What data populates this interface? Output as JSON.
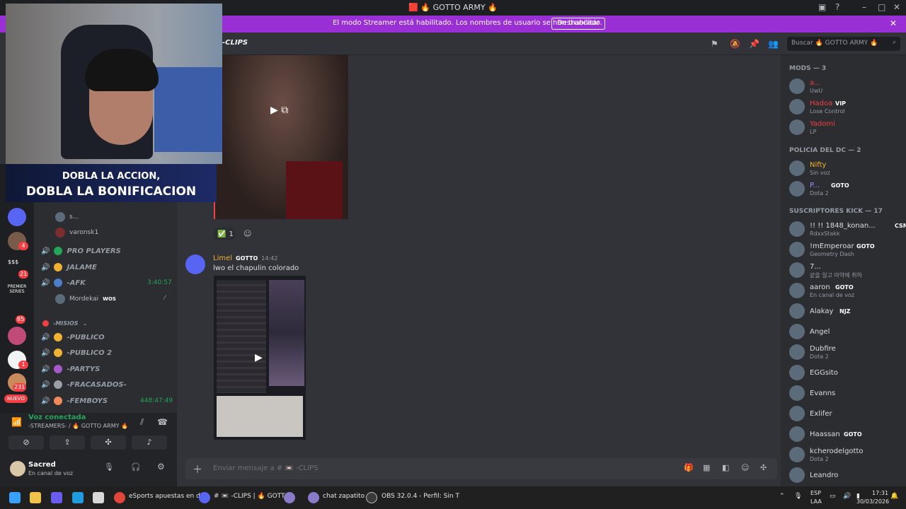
{
  "window": {
    "title": "🟥 🔥 GOTTO ARMY 🔥"
  },
  "banner": {
    "message": "El modo Streamer está habilitado. Los nombres de usuario se han truncado.",
    "button": "Deshabilitar"
  },
  "overlay": {
    "line1": "DOBLA LA ACCION,",
    "line2": "DOBLA LA BONIFICACION"
  },
  "rail": {
    "badges": [
      "4",
      "21",
      "85",
      "1",
      "231"
    ],
    "labels": [
      "$$$",
      "PREMIER SERIES"
    ],
    "new_label": "NUEVO"
  },
  "channels": {
    "voice_users_top": [
      "s...",
      "varonsk1"
    ],
    "items": [
      {
        "name": "PRO PLAYERS"
      },
      {
        "name": "JALAME"
      },
      {
        "name": "-AFK",
        "timer": "3:40:57"
      },
      {
        "name": "-PUBLICO"
      },
      {
        "name": "-PUBLICO 2"
      },
      {
        "name": "-PARTYS"
      },
      {
        "name": "-FRACASADOS-"
      },
      {
        "name": "-FEMBOYS",
        "timer": "448:47:49"
      }
    ],
    "afk_user": "Mordekai",
    "afk_user_tag": "WOS",
    "category": "-MISIOS"
  },
  "voice": {
    "title": "Voz conectada",
    "subtitle": "-STREAMERS- / 🔥 GOTTO ARMY 🔥"
  },
  "user": {
    "name": "Sacred",
    "status": "En canal de voz"
  },
  "header": {
    "channel": "-CLIPS",
    "search_placeholder": "Buscar 🔥 GOTTO ARMY 🔥"
  },
  "messages": {
    "reaction_count": "1",
    "author": "Limel",
    "author_tag": "GOTTO",
    "time": "14:42",
    "text": "lwo el chapulin colorado"
  },
  "input": {
    "placeholder": "Enviar mensaje a # 📼 -CLIPS"
  },
  "members": {
    "groups": [
      {
        "label": "MODS — 3",
        "rows": [
          {
            "name": "a...",
            "sub": "UwU",
            "color": "#f23f43"
          },
          {
            "name": "Hadoa",
            "sub": "Lose Control",
            "color": "#f23f43",
            "tag": "VIP"
          },
          {
            "name": "Yadomi",
            "sub": "LP",
            "color": "#f23f43"
          }
        ]
      },
      {
        "label": "POLICIA DEL DC — 2",
        "rows": [
          {
            "name": "Nifty",
            "sub": "Sin voz",
            "color": "#f0b232"
          },
          {
            "name": "P...",
            "sub": "Dota 2",
            "color": "#a58dff",
            "tag": "GOTO"
          }
        ]
      },
      {
        "label": "SUSCRIPTORES KICK — 17",
        "rows": [
          {
            "name": "!! !! 1848_konan...",
            "sub": "RdxxStakk",
            "color": "#dbdee1",
            "tag": "CSM"
          },
          {
            "name": "!mEmperoar",
            "sub": "Geometry Dash",
            "color": "#dbdee1",
            "tag": "GOTO"
          },
          {
            "name": "7...",
            "sub": "같을 일고 마약에 취하",
            "color": "#dbdee1"
          },
          {
            "name": "aaron",
            "sub": "En canal de voz",
            "color": "#dbdee1",
            "tag": "GOTO"
          },
          {
            "name": "Alakay",
            "sub": "",
            "color": "#dbdee1",
            "tag": "NJZ"
          },
          {
            "name": "Angel",
            "sub": "",
            "color": "#dbdee1"
          },
          {
            "name": "Dubfire",
            "sub": "Dota 2",
            "color": "#dbdee1"
          },
          {
            "name": "EGGsito",
            "sub": "",
            "color": "#dbdee1"
          },
          {
            "name": "Evanns",
            "sub": "",
            "color": "#dbdee1"
          },
          {
            "name": "Exlifer",
            "sub": "",
            "color": "#dbdee1"
          },
          {
            "name": "Haassan",
            "sub": "",
            "color": "#dbdee1",
            "tag": "GOTO"
          },
          {
            "name": "kcherodelgotto",
            "sub": "Dota 2",
            "color": "#dbdee1"
          },
          {
            "name": "Leandro",
            "sub": "",
            "color": "#dbdee1"
          }
        ]
      }
    ]
  },
  "taskbar": {
    "items": [
      "eSports apuestas en dir",
      "# 📼 -CLIPS | 🔥 GOTTO",
      "chat zapatito",
      "OBS 32.0.4 - Perfil: Sin T"
    ],
    "lang": "ESP",
    "lang2": "LAA",
    "clock": "17:31",
    "date": "30/03/2026"
  }
}
